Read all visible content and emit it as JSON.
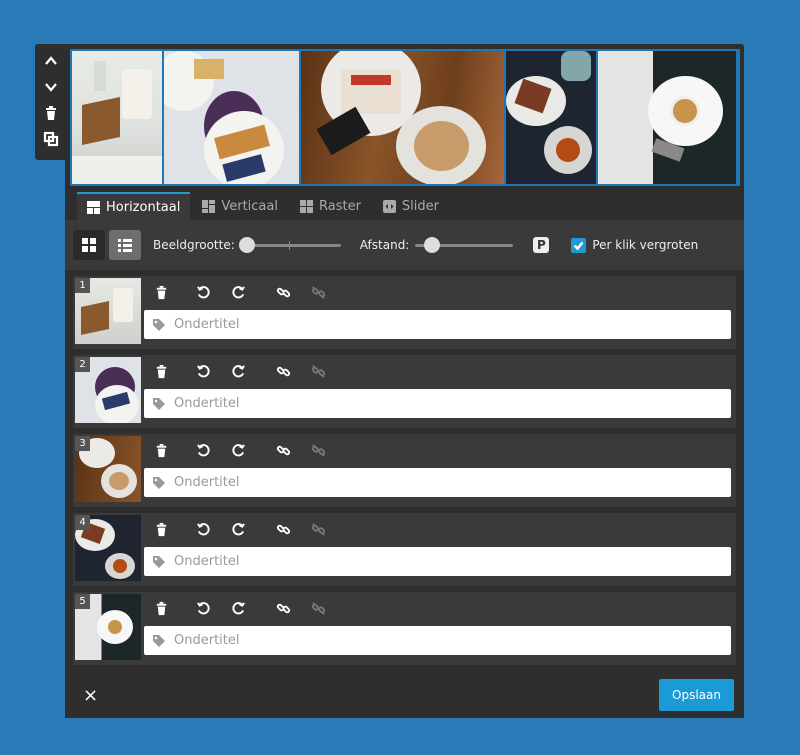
{
  "tabs": [
    {
      "label": "Horizontaal",
      "icon": "layout-horizontal-icon",
      "active": true
    },
    {
      "label": "Verticaal",
      "icon": "layout-vertical-icon",
      "active": false
    },
    {
      "label": "Raster",
      "icon": "layout-grid-icon",
      "active": false
    },
    {
      "label": "Slider",
      "icon": "layout-slider-icon",
      "active": false
    }
  ],
  "options": {
    "image_size_label": "Beeldgrootte:",
    "image_size_value": 0.0,
    "spacing_label": "Afstand:",
    "spacing_value": 0.1,
    "zoom_label": "Per klik vergroten",
    "zoom_checked": true
  },
  "rows": [
    {
      "number": "1",
      "placeholder": "Ondertitel"
    },
    {
      "number": "2",
      "placeholder": "Ondertitel"
    },
    {
      "number": "3",
      "placeholder": "Ondertitel"
    },
    {
      "number": "4",
      "placeholder": "Ondertitel"
    },
    {
      "number": "5",
      "placeholder": "Ondertitel"
    }
  ],
  "footer": {
    "close_label": "×",
    "save_label": "Opslaan"
  },
  "colors": {
    "page_background": "#2b7ab8",
    "panel": "#2e2e2e",
    "accent": "#1a9ad6"
  }
}
